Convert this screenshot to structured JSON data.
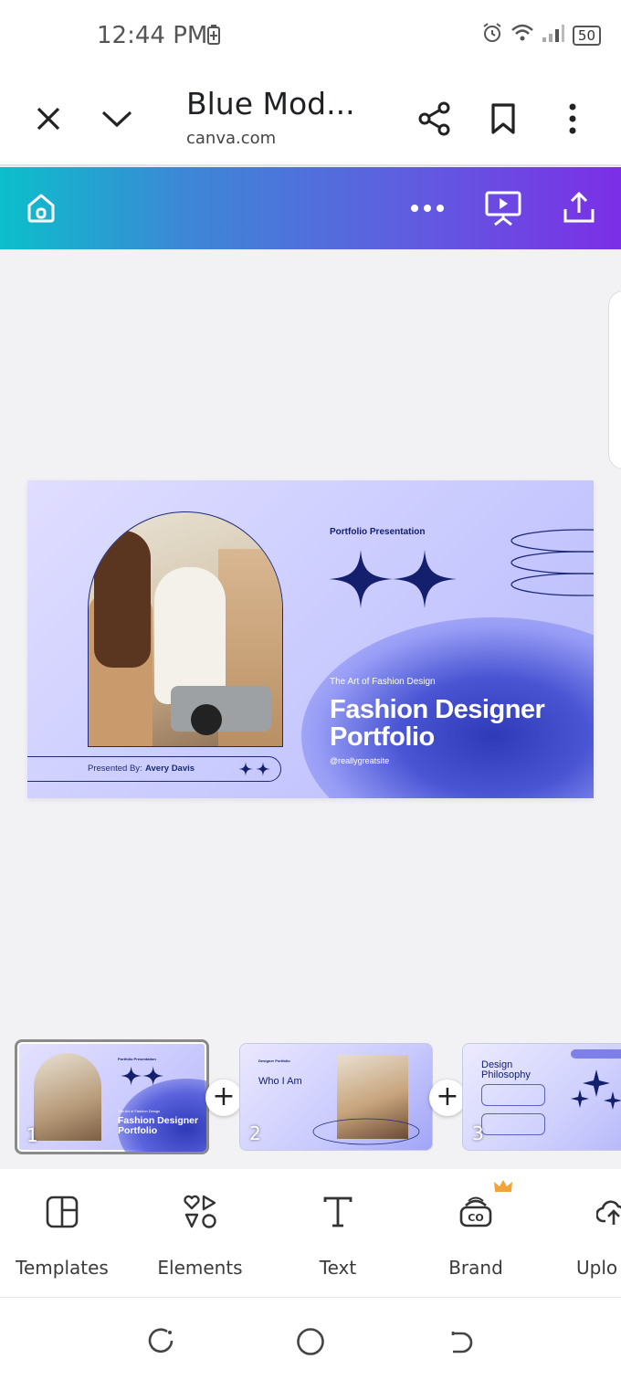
{
  "status_bar": {
    "time": "12:44 PM",
    "battery": "50"
  },
  "browser": {
    "title": "Blue Mod...",
    "url": "canva.com"
  },
  "canva_bar": {
    "icons": [
      "home-icon",
      "more-icon",
      "present-icon",
      "share-upload-icon"
    ]
  },
  "slide": {
    "portfolio_label": "Portfolio Presentation",
    "art_label": "The Art of Fashion Design",
    "title_line1": "Fashion Designer",
    "title_line2": "Portfolio",
    "handle": "@reallygreatsite",
    "presented_label": "Presented By:",
    "presented_name": "Avery Davis"
  },
  "thumbnails": [
    {
      "number": "1",
      "title": "Fashion Designer Portfolio",
      "label": "Portfolio Presentation",
      "subtitle": "The Art of Fashion Design"
    },
    {
      "number": "2",
      "heading": "Who I Am",
      "label": "Designer Portfolio"
    },
    {
      "number": "3",
      "heading": "Design Philosophy"
    }
  ],
  "tools": [
    {
      "label": "Templates",
      "icon": "templates-icon"
    },
    {
      "label": "Elements",
      "icon": "elements-icon"
    },
    {
      "label": "Text",
      "icon": "text-icon"
    },
    {
      "label": "Brand",
      "icon": "brand-icon"
    },
    {
      "label": "Uplo",
      "icon": "upload-icon"
    }
  ],
  "colors": {
    "accent_navy": "#14206e",
    "toolbar_start": "#0bbfcb",
    "toolbar_end": "#7b2fe6",
    "premium_crown": "#f2a43a"
  }
}
